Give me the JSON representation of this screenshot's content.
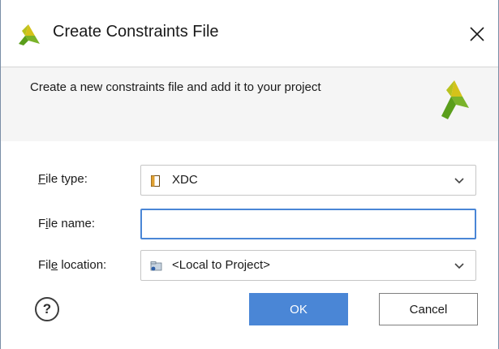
{
  "window": {
    "title": "Create Constraints File",
    "close_glyph": "✕"
  },
  "header": {
    "description": "Create a new constraints file and add it to your project"
  },
  "form": {
    "file_type": {
      "label_mnemonic": "F",
      "label_rest": "ile type:",
      "value": "XDC",
      "icon": "xdc-file-icon"
    },
    "file_name": {
      "label_pre": "F",
      "label_mnemonic": "i",
      "label_rest": "le name:",
      "value": "",
      "placeholder": ""
    },
    "file_location": {
      "label_pre": "Fil",
      "label_mnemonic": "e",
      "label_rest": " location:",
      "value": "<Local to Project>",
      "icon": "folder-icon"
    }
  },
  "buttons": {
    "help": "?",
    "ok": "OK",
    "cancel": "Cancel"
  },
  "colors": {
    "accent": "#4a86d6",
    "logo_green": "#5a9e1b",
    "logo_yellow": "#d4c21a"
  }
}
